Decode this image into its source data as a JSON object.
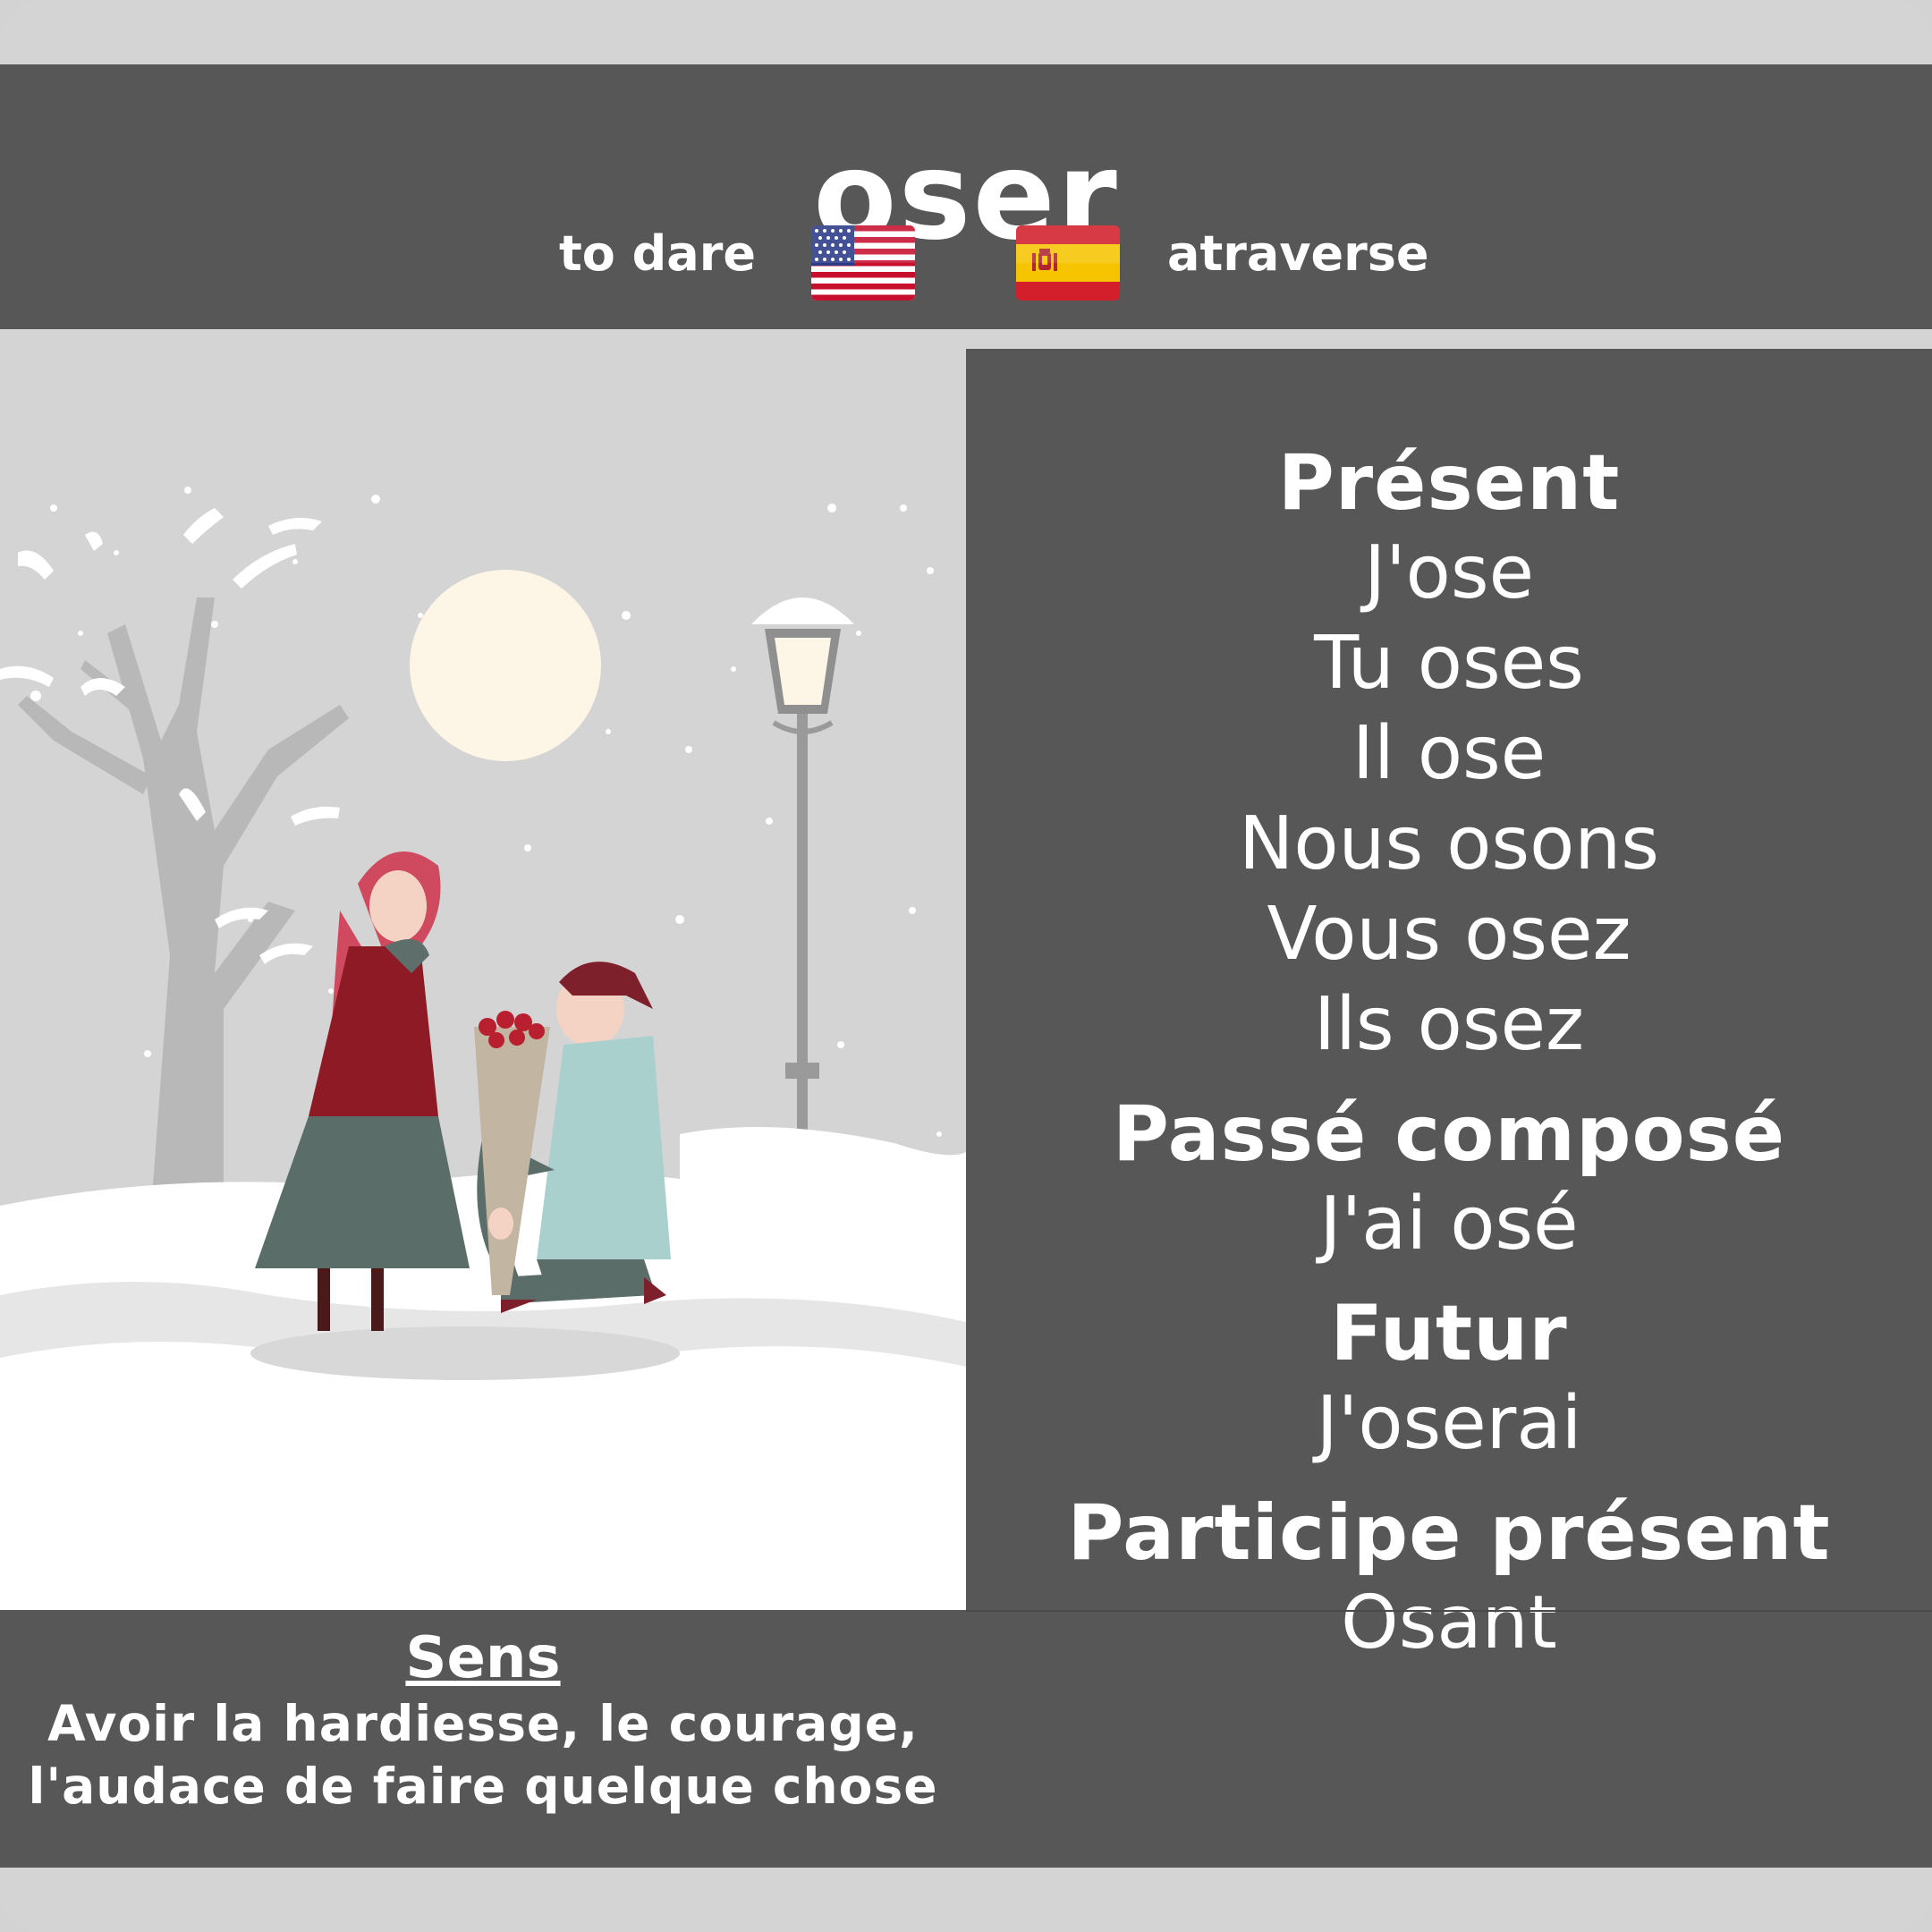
{
  "verb": "oser",
  "translations": {
    "english": "to dare",
    "spanish": "atraverse"
  },
  "flags": {
    "english": "us-flag",
    "spanish": "spain-flag"
  },
  "illustration": "winter-proposal-illustration",
  "conjugation": {
    "present": {
      "title": "Présent",
      "forms": [
        "J'ose",
        "Tu oses",
        "Il ose",
        "Nous osons",
        "Vous osez",
        "Ils osez"
      ]
    },
    "passe_compose": {
      "title": "Passé composé",
      "forms": [
        "J'ai osé"
      ]
    },
    "futur": {
      "title": "Futur",
      "forms": [
        "J'oserai"
      ]
    },
    "participe_present": {
      "title": "Participe présent",
      "forms": [
        "Osant"
      ]
    }
  },
  "sens": {
    "title": "Sens",
    "lines": [
      "Avoir la hardiesse, le courage,",
      "l'audace de faire quelque chose"
    ]
  },
  "colors": {
    "panel": "#575757",
    "background": "#d4d4d4",
    "text": "#ffffff"
  }
}
